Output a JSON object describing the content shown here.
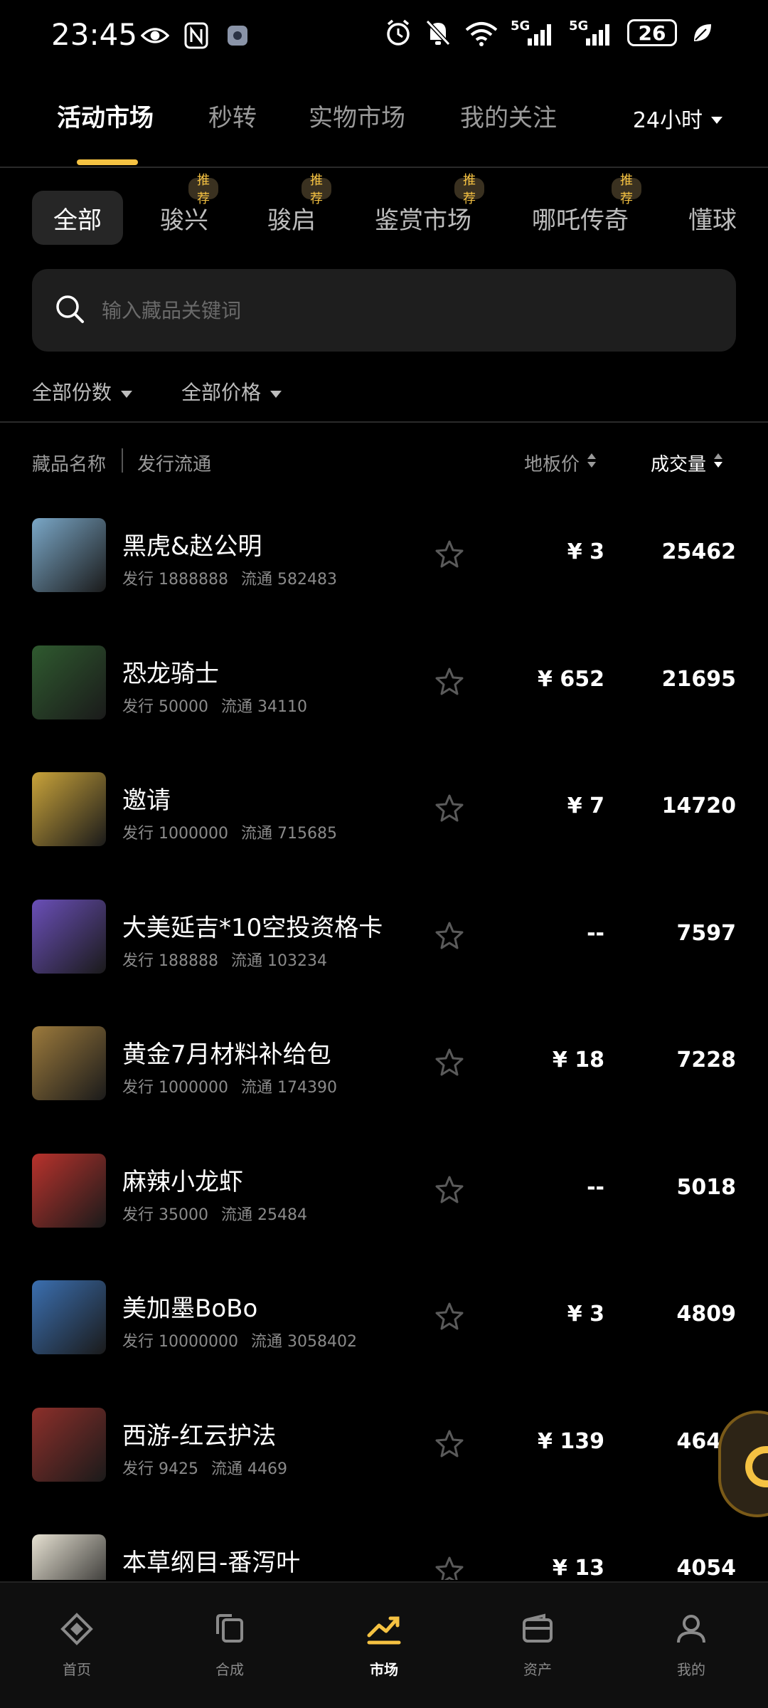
{
  "status_bar": {
    "time": "23:45",
    "battery": "26",
    "network_1": "5G",
    "network_2": "5G",
    "wifi_label": "6"
  },
  "top_tabs": [
    {
      "label": "活动市场",
      "active": true
    },
    {
      "label": "秒转",
      "active": false
    },
    {
      "label": "实物市场",
      "active": false
    },
    {
      "label": "我的关注",
      "active": false
    }
  ],
  "time_range": "24小时",
  "categories": [
    {
      "label": "全部",
      "active": true,
      "badge": ""
    },
    {
      "label": "骏兴",
      "active": false,
      "badge": "推荐"
    },
    {
      "label": "骏启",
      "active": false,
      "badge": "推荐"
    },
    {
      "label": "鉴赏市场",
      "active": false,
      "badge": "推荐"
    },
    {
      "label": "哪吒传奇",
      "active": false,
      "badge": "推荐"
    },
    {
      "label": "懂球",
      "active": false,
      "badge": ""
    }
  ],
  "search": {
    "placeholder": "输入藏品关键词"
  },
  "filters": {
    "quantity": "全部份数",
    "price": "全部价格"
  },
  "columns": {
    "name": "藏品名称",
    "issue": "发行流通",
    "price": "地板价",
    "volume": "成交量"
  },
  "items": [
    {
      "name": "黑虎&赵公明",
      "issue": "发行 1888888",
      "circulation": "流通 582483",
      "price": "¥ 3",
      "volume": "25462",
      "thumb_color": "#7aa7c7"
    },
    {
      "name": "恐龙骑士",
      "issue": "发行 50000",
      "circulation": "流通 34110",
      "price": "¥ 652",
      "volume": "21695",
      "thumb_color": "#2f5a2f"
    },
    {
      "name": "邀请",
      "issue": "发行 1000000",
      "circulation": "流通 715685",
      "price": "¥ 7",
      "volume": "14720",
      "thumb_color": "#c9a33a"
    },
    {
      "name": "大美延吉*10空投资格卡",
      "issue": "发行 188888",
      "circulation": "流通 103234",
      "price": "--",
      "volume": "7597",
      "thumb_color": "#6a4fb8"
    },
    {
      "name": "黄金7月材料补给包",
      "issue": "发行 1000000",
      "circulation": "流通 174390",
      "price": "¥ 18",
      "volume": "7228",
      "thumb_color": "#9c7a3c"
    },
    {
      "name": "麻辣小龙虾",
      "issue": "发行 35000",
      "circulation": "流通 25484",
      "price": "--",
      "volume": "5018",
      "thumb_color": "#b8322c"
    },
    {
      "name": "美加墨BoBo",
      "issue": "发行 10000000",
      "circulation": "流通 3058402",
      "price": "¥ 3",
      "volume": "4809",
      "thumb_color": "#3b6fb0"
    },
    {
      "name": "西游-红云护法",
      "issue": "发行 9425",
      "circulation": "流通 4469",
      "price": "¥ 139",
      "volume": "4643",
      "thumb_color": "#8c2f2a"
    },
    {
      "name": "本草纲目-番泻叶",
      "issue": "",
      "circulation": "",
      "price": "¥ 13",
      "volume": "4054",
      "thumb_color": "#e6e1d2"
    }
  ],
  "bottom_nav": [
    {
      "label": "首页",
      "icon": "home-diamond-icon",
      "active": false
    },
    {
      "label": "合成",
      "icon": "synthesis-icon",
      "active": false
    },
    {
      "label": "市场",
      "icon": "market-trend-icon",
      "active": true
    },
    {
      "label": "资产",
      "icon": "wallet-icon",
      "active": false
    },
    {
      "label": "我的",
      "icon": "profile-icon",
      "active": false
    }
  ],
  "accent_color": "#f5c242"
}
